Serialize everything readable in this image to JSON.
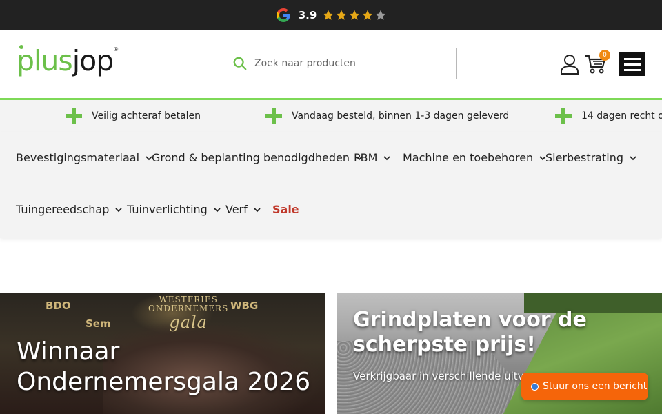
{
  "rating": {
    "score": "3.9",
    "stars_filled": 4,
    "stars_total": 5,
    "provider_icon": "google-icon"
  },
  "header": {
    "logo": {
      "plus": "plus",
      "jop": "jop",
      "reg": "®"
    },
    "search": {
      "placeholder": "Zoek naar producten",
      "value": ""
    },
    "cart_count": "0",
    "icons": [
      "search-icon",
      "user-icon",
      "cart-icon",
      "menu-icon"
    ]
  },
  "usp": [
    {
      "text": "Veilig achteraf betalen"
    },
    {
      "text": "Vandaag besteld, binnen 1-3 dagen geleverd"
    },
    {
      "text": "14 dagen recht op"
    }
  ],
  "categories": [
    {
      "label": "Bevestigingsmateriaal"
    },
    {
      "label": "Grond & beplanting benodigdheden"
    },
    {
      "label": "PBM"
    },
    {
      "label": "Machine en toebehoren"
    },
    {
      "label": "Sierbestrating"
    },
    {
      "label": "Tuingereedschap"
    },
    {
      "label": "Tuinverlichting"
    },
    {
      "label": "Verf"
    },
    {
      "label": "Sale"
    }
  ],
  "banners": {
    "left": {
      "title_line1": "Winnaar",
      "title_line2": "Ondernemersgala 2026",
      "sign_top": "WESTFRIES",
      "sign_mid": "ONDERNEMERS",
      "sign_big": "gala",
      "sponsors": [
        "BDO",
        "Sem",
        "WBG"
      ]
    },
    "right": {
      "title_line1": "Grindplaten voor de",
      "title_line2": "scherpste prijs!",
      "subtitle": "Verkrijgbaar in verschillende uitv"
    }
  },
  "chat": {
    "label": "Stuur ons een bericht"
  },
  "colors": {
    "brand_green": "#6cc04a",
    "topbar": "#222222",
    "chat_orange": "#f5650a",
    "sale_red": "#c0392b",
    "badge_orange": "#f08a12"
  }
}
